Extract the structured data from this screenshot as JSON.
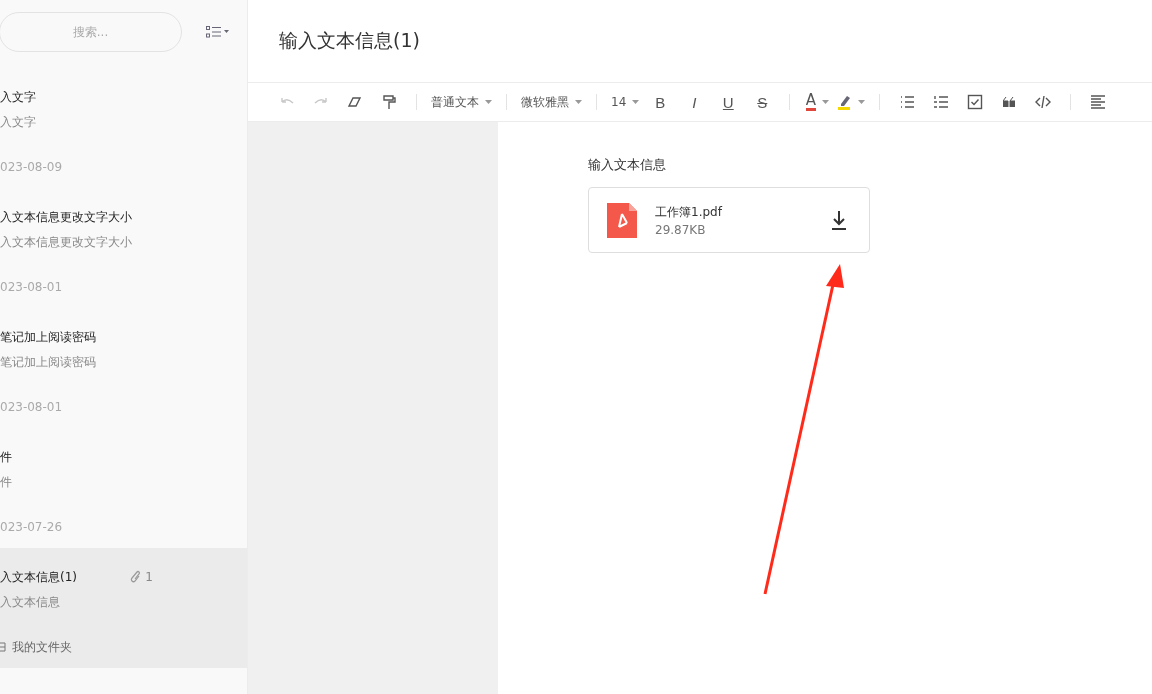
{
  "sidebar": {
    "search": {
      "placeholder": "搜索..."
    },
    "notes": [
      {
        "title": "入文字",
        "preview": "入文字",
        "date": "023-08-09",
        "selected": false
      },
      {
        "title": "入文本信息更改文字大小",
        "preview": "入文本信息更改文字大小",
        "date": "023-08-01",
        "selected": false
      },
      {
        "title": "笔记加上阅读密码",
        "preview": "笔记加上阅读密码",
        "date": "023-08-01",
        "selected": false
      },
      {
        "title": "件",
        "preview": "件",
        "date": "023-07-26",
        "selected": false
      },
      {
        "title": "入文本信息(1)",
        "preview": "入文本信息",
        "folder": "我的文件夹",
        "attachments": "1",
        "selected": true
      }
    ]
  },
  "note": {
    "title": "输入文本信息(1)",
    "body": "输入文本信息",
    "attachment": {
      "name": "工作簿1.pdf",
      "size": "29.87KB"
    }
  },
  "toolbar": {
    "undo": {
      "disabled": true
    },
    "redo": {
      "disabled": true
    },
    "block_style": "普通文本",
    "font": "微软雅黑",
    "size": "14",
    "formats": [
      "B",
      "I",
      "U",
      "S"
    ],
    "text_color": "A"
  }
}
